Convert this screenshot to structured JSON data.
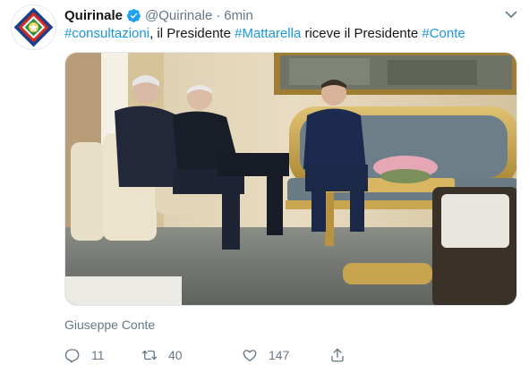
{
  "tweet": {
    "display_name": "Quirinale",
    "handle": "@Quirinale",
    "separator": "·",
    "time": "6min",
    "text_parts": [
      {
        "text": "#consultazioni",
        "type": "hashtag"
      },
      {
        "text": ", il Presidente ",
        "type": "plain"
      },
      {
        "text": "#Mattarella",
        "type": "hashtag"
      },
      {
        "text": " riceve il Presidente ",
        "type": "plain"
      },
      {
        "text": "#Conte",
        "type": "hashtag"
      }
    ],
    "photo_tag": "Giuseppe Conte",
    "counts": {
      "replies": "11",
      "retweets": "40",
      "likes": "147"
    }
  },
  "colors": {
    "link": "#1b95e0",
    "verified": "#1da1f2",
    "muted": "#657786"
  },
  "icons": [
    "quirinale-emblem-icon",
    "verified-badge-icon",
    "chevron-down-icon",
    "reply-icon",
    "retweet-icon",
    "like-icon",
    "share-icon"
  ]
}
